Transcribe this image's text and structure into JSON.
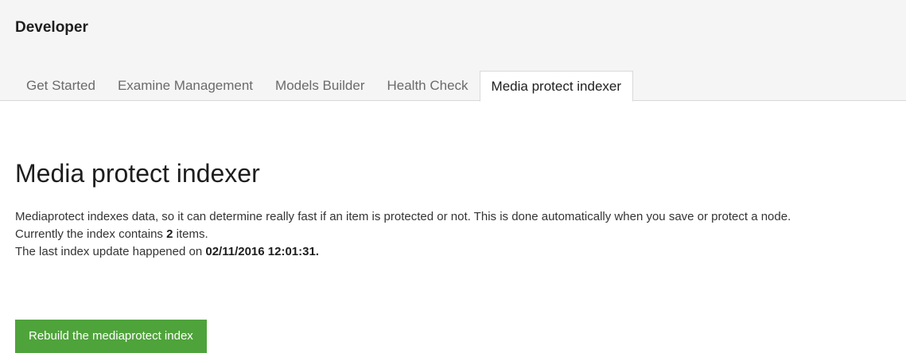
{
  "header": {
    "section_title": "Developer",
    "tabs": [
      {
        "label": "Get Started",
        "active": false
      },
      {
        "label": "Examine Management",
        "active": false
      },
      {
        "label": "Models Builder",
        "active": false
      },
      {
        "label": "Health Check",
        "active": false
      },
      {
        "label": "Media protect indexer",
        "active": true
      }
    ]
  },
  "main": {
    "title": "Media protect indexer",
    "description_line1": "Mediaprotect indexes data, so it can determine really fast if an item is protected or not. This is done automatically when you save or protect a node.",
    "index_count_prefix": "Currently the index contains ",
    "index_count": "2",
    "index_count_suffix": " items.",
    "last_update_prefix": "The last index update happened on ",
    "last_update_value": "02/11/2016 12:01:31",
    "last_update_suffix": ".",
    "rebuild_button_label": "Rebuild the mediaprotect index"
  },
  "colors": {
    "header_background": "#f5f5f5",
    "button_green": "#4fa33b",
    "text": "#343434"
  }
}
